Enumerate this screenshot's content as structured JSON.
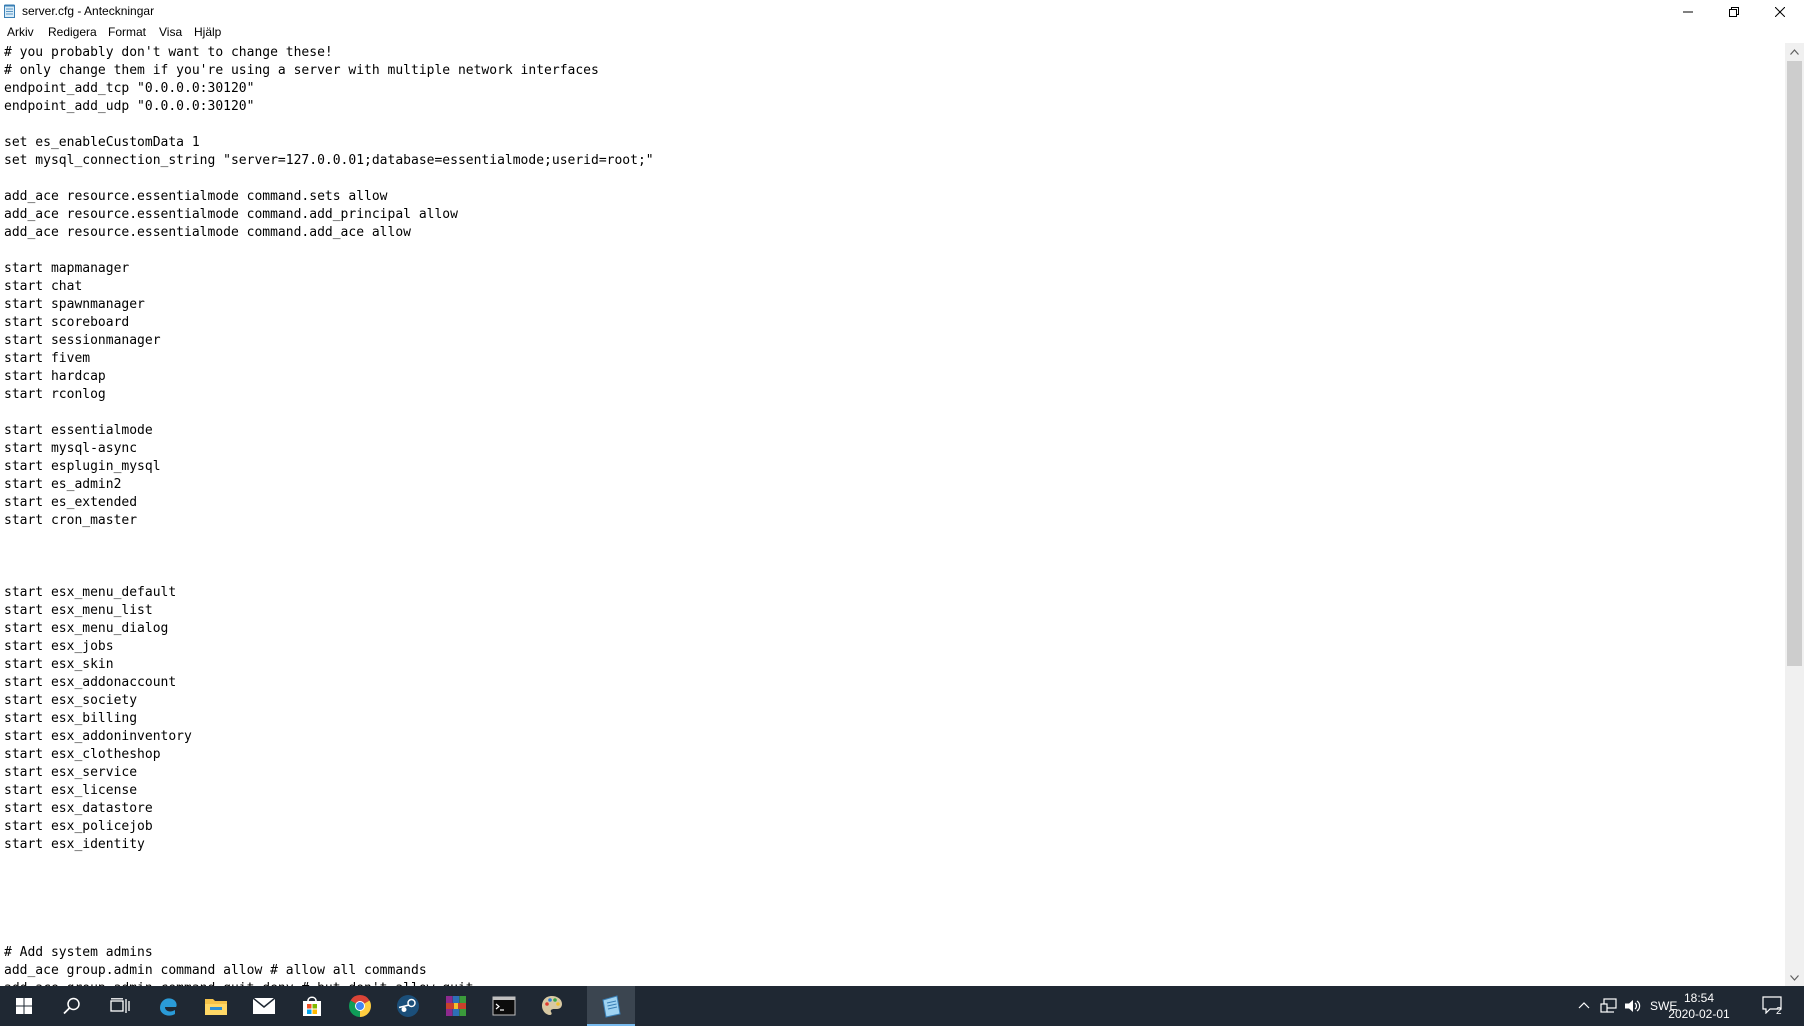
{
  "window": {
    "title": "server.cfg - Anteckningar",
    "icon": "notepad-icon"
  },
  "menu": {
    "items": [
      "Arkiv",
      "Redigera",
      "Format",
      "Visa",
      "Hjälp"
    ]
  },
  "editor": {
    "content": "# you probably don't want to change these!\n# only change them if you're using a server with multiple network interfaces\nendpoint_add_tcp \"0.0.0.0:30120\"\nendpoint_add_udp \"0.0.0.0:30120\"\n\nset es_enableCustomData 1\nset mysql_connection_string \"server=127.0.0.01;database=essentialmode;userid=root;\"\n\nadd_ace resource.essentialmode command.sets allow\nadd_ace resource.essentialmode command.add_principal allow\nadd_ace resource.essentialmode command.add_ace allow\n\nstart mapmanager\nstart chat\nstart spawnmanager\nstart scoreboard\nstart sessionmanager\nstart fivem\nstart hardcap\nstart rconlog\n\nstart essentialmode\nstart mysql-async\nstart esplugin_mysql\nstart es_admin2\nstart es_extended\nstart cron_master\n\n\n\nstart esx_menu_default\nstart esx_menu_list\nstart esx_menu_dialog\nstart esx_jobs\nstart esx_skin\nstart esx_addonaccount\nstart esx_society\nstart esx_billing\nstart esx_addoninventory\nstart esx_clotheshop\nstart esx_service\nstart esx_license\nstart esx_datastore\nstart esx_policejob\nstart esx_identity\n\n\n\n\n\n# Add system admins\nadd_ace group.admin command allow # allow all commands\nadd_ace group.admin command.quit deny # but don't allow quit"
  },
  "taskbar": {
    "apps": [
      {
        "name": "start-icon",
        "active": false
      },
      {
        "name": "search-icon",
        "active": false
      },
      {
        "name": "task-view-icon",
        "active": false
      },
      {
        "name": "edge-icon",
        "active": false
      },
      {
        "name": "file-explorer-icon",
        "active": false
      },
      {
        "name": "mail-icon",
        "active": false
      },
      {
        "name": "store-icon",
        "active": false
      },
      {
        "name": "chrome-icon",
        "active": false
      },
      {
        "name": "steam-icon",
        "active": false
      },
      {
        "name": "winrar-icon",
        "active": false
      },
      {
        "name": "terminal-icon",
        "active": false
      },
      {
        "name": "paint-icon",
        "active": false
      },
      {
        "name": "notepad-icon",
        "active": true
      }
    ],
    "tray": {
      "language": "SWE",
      "time": "18:54",
      "date": "2020-02-01",
      "notification_count": "2"
    }
  },
  "colors": {
    "taskbar_bg": "#1f2833",
    "active_accent": "#76b9ed",
    "scroll_thumb": "#cdcdcd"
  }
}
